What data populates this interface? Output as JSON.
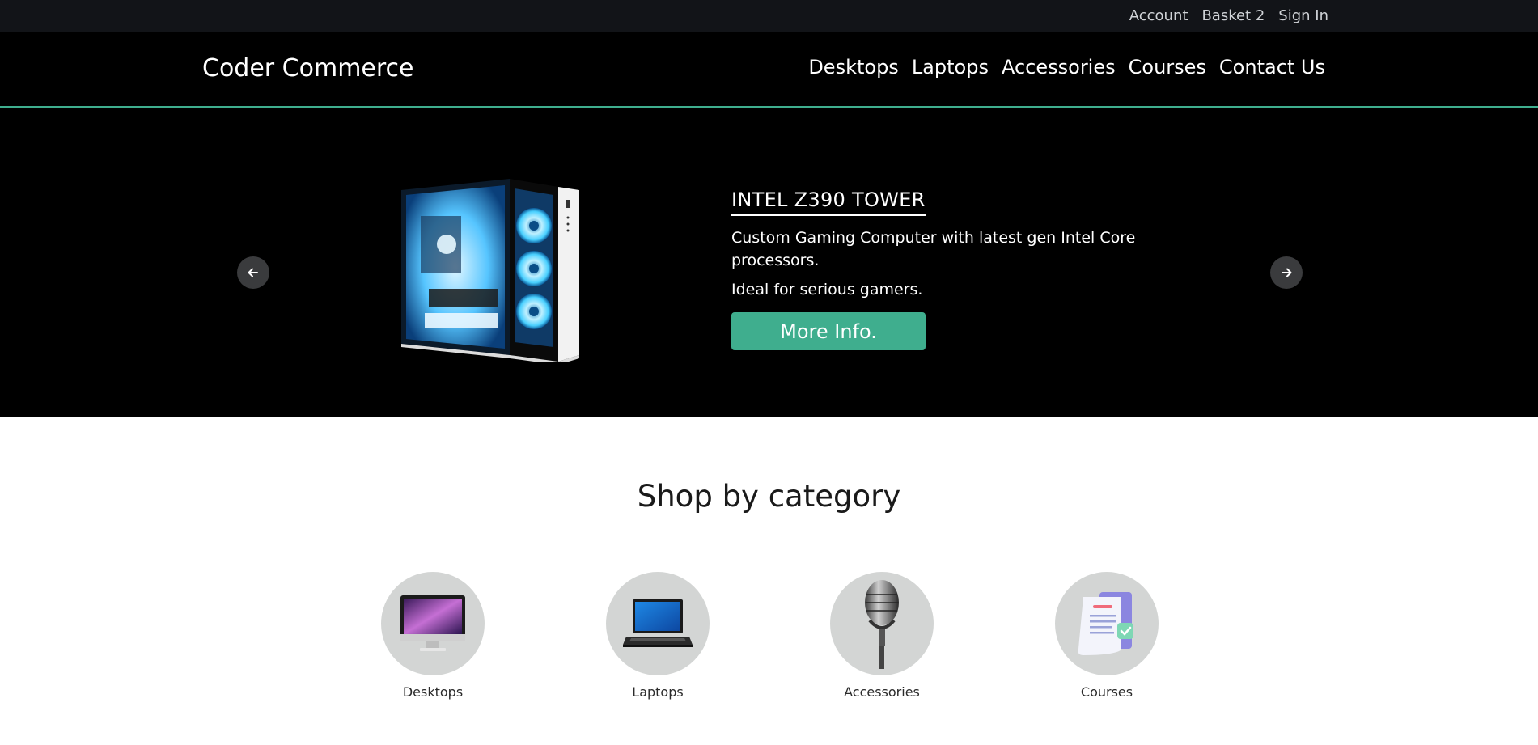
{
  "topbar": {
    "account": "Account",
    "basket": "Basket 2",
    "signin": "Sign In"
  },
  "header": {
    "brand": "Coder Commerce",
    "nav": [
      "Desktops",
      "Laptops",
      "Accessories",
      "Courses",
      "Contact Us"
    ]
  },
  "carousel": {
    "title": "INTEL Z390 TOWER",
    "description": "Custom Gaming Computer with latest gen Intel Core processors.",
    "note": "Ideal for serious gamers.",
    "button": "More Info."
  },
  "categories": {
    "title": "Shop by category",
    "items": [
      {
        "label": "Desktops",
        "icon": "desktop-icon"
      },
      {
        "label": "Laptops",
        "icon": "laptop-icon"
      },
      {
        "label": "Accessories",
        "icon": "microphone-icon"
      },
      {
        "label": "Courses",
        "icon": "document-icon"
      }
    ]
  },
  "colors": {
    "accent": "#3fae8e",
    "header_bg": "#000000",
    "topbar_bg": "#121418",
    "circle_bg": "#d3d5d4"
  }
}
